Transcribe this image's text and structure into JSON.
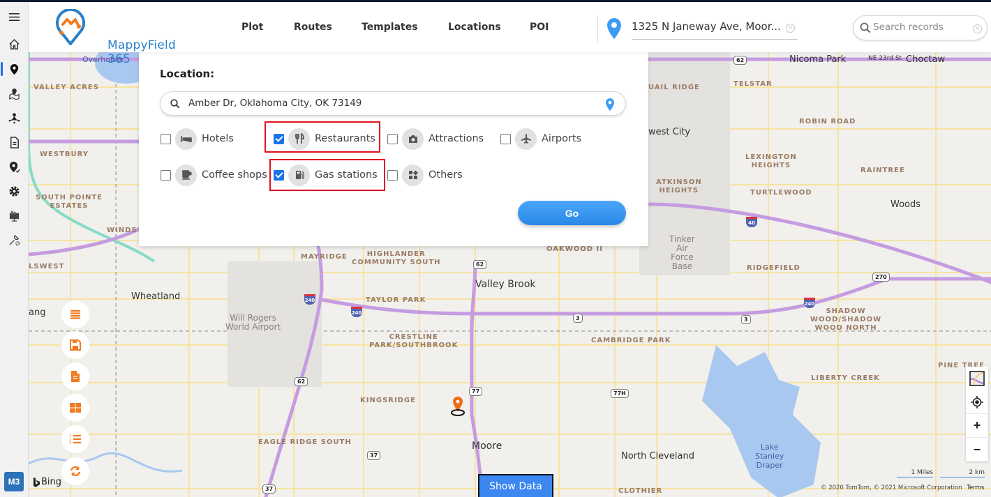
{
  "app": {
    "name": "MappyField 365",
    "badge": "M3",
    "colors": {
      "brand_blue": "#2a7fc9",
      "brand_orange": "#f07c22",
      "accent": "#1a73e8",
      "highlight_red": "#e0121f",
      "go_button": "#3a97f2"
    }
  },
  "sidebar": {
    "items": [
      {
        "name": "menu",
        "icon": "hamburger-icon"
      },
      {
        "name": "home",
        "icon": "home-icon"
      },
      {
        "name": "plot",
        "icon": "map-pin-icon",
        "active": true
      },
      {
        "name": "map-area",
        "icon": "map-area-icon"
      },
      {
        "name": "territory",
        "icon": "territory-icon"
      },
      {
        "name": "document",
        "icon": "document-icon"
      },
      {
        "name": "checkin",
        "icon": "pin-check-icon"
      },
      {
        "name": "settings",
        "icon": "gear-icon"
      },
      {
        "name": "dashboard",
        "icon": "dashboard-icon"
      },
      {
        "name": "tools",
        "icon": "tools-icon"
      }
    ]
  },
  "header": {
    "nav": [
      "Plot",
      "Routes",
      "Templates",
      "Locations",
      "POI"
    ],
    "address": "1325 N Janeway Ave, Moor...",
    "search_placeholder": "Search records"
  },
  "poi_panel": {
    "title": "Location:",
    "location_value": "Amber Dr, Oklahoma City, OK 73149",
    "categories": [
      {
        "label": "Hotels",
        "icon": "bed-icon",
        "checked": false
      },
      {
        "label": "Restaurants",
        "icon": "fork-knife-icon",
        "checked": true
      },
      {
        "label": "Attractions",
        "icon": "camera-icon",
        "checked": false
      },
      {
        "label": "Airports",
        "icon": "airplane-icon",
        "checked": false
      },
      {
        "label": "Coffee shops",
        "icon": "coffee-icon",
        "checked": false
      },
      {
        "label": "Gas stations",
        "icon": "gas-pump-icon",
        "checked": true
      },
      {
        "label": "Others",
        "icon": "others-icon",
        "checked": false
      }
    ],
    "go_label": "Go"
  },
  "map": {
    "labels": {
      "overholser": "Overholser",
      "valley_acres": "VALLEY ACRES",
      "westbury": "WESTBURY",
      "south_pointe": "SOUTH POINTE\nESTATES",
      "winds_w": "WINDS W",
      "lswest": "LSWEST",
      "wheatland": "Wheatland",
      "ang": "ang",
      "will_rogers": "Will Rogers\nWorld Airport",
      "mayridge": "MAYRIDGE",
      "highlander": "HIGHLANDER\nCOMMUNITY SOUTH",
      "taylor_park": "TAYLOR PARK",
      "crestline": "CRESTLINE\nPARK/SOUTHBROOK",
      "oakwood": "OAKWOOD II",
      "valley_brook": "Valley Brook",
      "cambridge": "CAMBRIDGE PARK",
      "kingsridge": "KINGSRIDGE",
      "eagle_ridge": "EAGLE RIDGE SOUTH",
      "moore": "Moore",
      "north_cleveland": "North Cleveland",
      "clothier": "CLOTHIER",
      "lake_stanley": "Lake\nStanley\nDraper",
      "liberty_creek": "LIBERTY CREEK",
      "pine_tree": "PINE TREE",
      "shadow_wood": "SHADOW\nWOOD/SHADOW\nWOOD NORTH",
      "ridgefield": "RIDGEFIELD",
      "tinker": "Tinker\nAir\nForce\nBase",
      "woods": "Woods",
      "turtlewood": "TURTLEWOOD",
      "atkinson": "ATKINSON\nHEIGHTS",
      "lexington": "LEXINGTON\nHEIGHTS",
      "raintree": "RAINTREE",
      "robin_road": "ROBIN ROAD",
      "west_city": "west City",
      "quail_ridge": "UAIL RIDGE",
      "telstar": "TELSTAR",
      "nicoma_park": "Nicoma Park",
      "ne23": "NE 23rd St",
      "choctaw": "Choctaw"
    },
    "shields": {
      "us62_top": "62",
      "us62_mid": "62",
      "us62_low": "62",
      "i240_a": "240",
      "i240_b": "240",
      "i240_c": "240",
      "i40": "40",
      "us270": "270",
      "sh3_a": "3",
      "sh3_b": "3",
      "us77": "77",
      "sh77h": "77H",
      "sh37_a": "37",
      "sh37_b": "37"
    },
    "scale_miles": "1 Miles",
    "scale_km": "2 km",
    "attribution": "© 2020 TomTom, © 2021 Microsoft Corporation",
    "terms": "Terms",
    "provider": "Bing",
    "show_data_label": "Show Data"
  },
  "float_buttons": [
    "list-icon",
    "save-icon",
    "file-icon",
    "grid-icon",
    "numbered-list-icon",
    "refresh-icon"
  ],
  "map_controls": [
    "map-style-icon",
    "locate-icon",
    "zoom-in-icon",
    "zoom-out-icon"
  ]
}
